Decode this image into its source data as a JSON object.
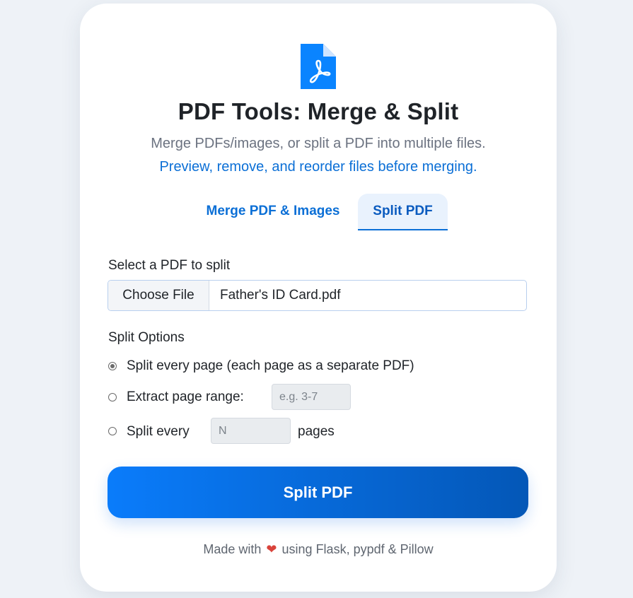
{
  "header": {
    "logo_icon": "pdf-file-icon",
    "title": "PDF Tools: Merge & Split",
    "subtitle": "Merge PDFs/images, or split a PDF into multiple files.",
    "subtitle_highlight": "Preview, remove, and reorder files before merging."
  },
  "tabs": [
    {
      "label": "Merge PDF & Images",
      "active": false
    },
    {
      "label": "Split PDF",
      "active": true
    }
  ],
  "split_form": {
    "file_label": "Select a PDF to split",
    "choose_button": "Choose File",
    "file_name": "Father's ID Card.pdf",
    "options_label": "Split Options",
    "options": [
      {
        "label": "Split every page (each page as a separate PDF)",
        "checked": true
      },
      {
        "label": "Extract page range:",
        "checked": false,
        "input_placeholder": "e.g. 3-7"
      },
      {
        "label": "Split every",
        "checked": false,
        "input_placeholder": "N",
        "suffix": "pages"
      }
    ],
    "submit_label": "Split PDF"
  },
  "footer": {
    "prefix": "Made with",
    "heart_icon": "heart-icon",
    "suffix": "using Flask, pypdf & Pillow"
  },
  "colors": {
    "accent": "#0b6fd6",
    "button_gradient_start": "#0a7cfb",
    "button_gradient_end": "#0457b7",
    "heart": "#d9433b"
  }
}
